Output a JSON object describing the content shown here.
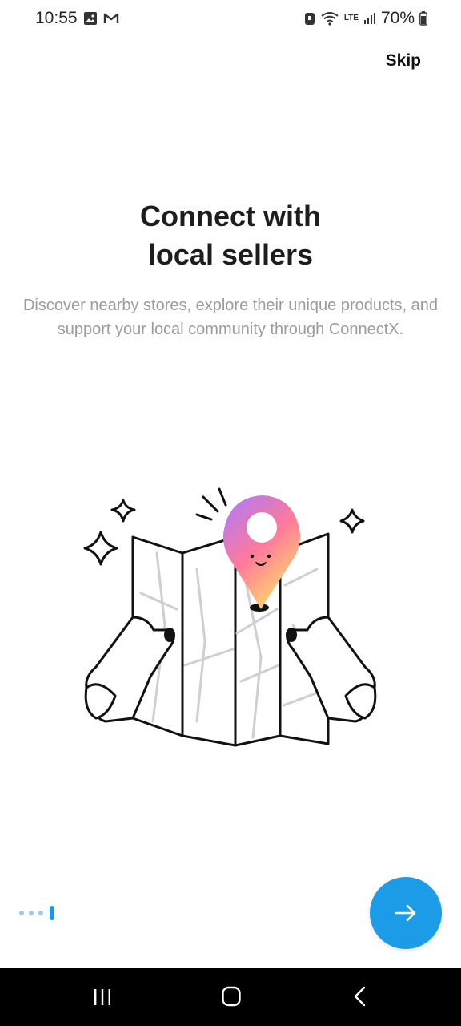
{
  "status_bar": {
    "time": "10:55",
    "battery": "70%",
    "network_label": "LTE"
  },
  "skip_label": "Skip",
  "onboarding": {
    "title_line1": "Connect with",
    "title_line2": "local sellers",
    "description": "Discover nearby stores, explore their unique products, and support your local community through ConnectX."
  },
  "pager": {
    "total": 4,
    "active_index": 3
  },
  "colors": {
    "accent": "#1c9be6",
    "pager_inactive": "#9cc9f0",
    "pin_gradient": [
      "#a77bff",
      "#ff7a9a",
      "#ffd66b"
    ]
  },
  "icons": {
    "next": "arrow-right-icon",
    "recents": "recents-icon",
    "home": "home-icon",
    "back": "back-icon"
  }
}
